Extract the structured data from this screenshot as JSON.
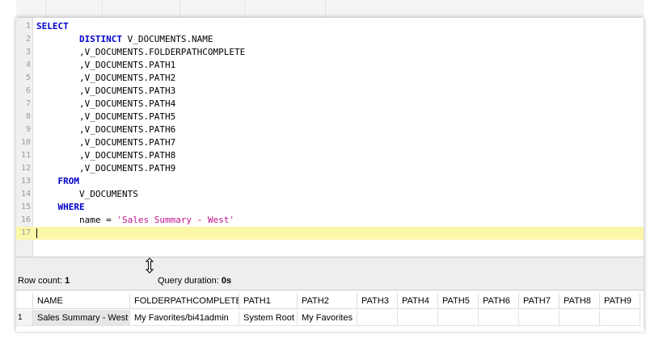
{
  "editor": {
    "lines": [
      {
        "n": "1",
        "segments": [
          {
            "t": "SELECT",
            "c": "kw"
          }
        ]
      },
      {
        "n": "2",
        "segments": [
          {
            "t": "        ",
            "c": ""
          },
          {
            "t": "DISTINCT",
            "c": "kw"
          },
          {
            "t": " V_DOCUMENTS.NAME",
            "c": ""
          }
        ]
      },
      {
        "n": "3",
        "segments": [
          {
            "t": "        ,V_DOCUMENTS.FOLDERPATHCOMPLETE",
            "c": ""
          }
        ]
      },
      {
        "n": "4",
        "segments": [
          {
            "t": "        ,V_DOCUMENTS.PATH1",
            "c": ""
          }
        ]
      },
      {
        "n": "5",
        "segments": [
          {
            "t": "        ,V_DOCUMENTS.PATH2",
            "c": ""
          }
        ]
      },
      {
        "n": "6",
        "segments": [
          {
            "t": "        ,V_DOCUMENTS.PATH3",
            "c": ""
          }
        ]
      },
      {
        "n": "7",
        "segments": [
          {
            "t": "        ,V_DOCUMENTS.PATH4",
            "c": ""
          }
        ]
      },
      {
        "n": "8",
        "segments": [
          {
            "t": "        ,V_DOCUMENTS.PATH5",
            "c": ""
          }
        ]
      },
      {
        "n": "9",
        "segments": [
          {
            "t": "        ,V_DOCUMENTS.PATH6",
            "c": ""
          }
        ]
      },
      {
        "n": "10",
        "segments": [
          {
            "t": "        ,V_DOCUMENTS.PATH7",
            "c": ""
          }
        ]
      },
      {
        "n": "11",
        "segments": [
          {
            "t": "        ,V_DOCUMENTS.PATH8",
            "c": ""
          }
        ]
      },
      {
        "n": "12",
        "segments": [
          {
            "t": "        ,V_DOCUMENTS.PATH9",
            "c": ""
          }
        ]
      },
      {
        "n": "13",
        "segments": [
          {
            "t": "    ",
            "c": ""
          },
          {
            "t": "FROM",
            "c": "kw"
          }
        ]
      },
      {
        "n": "14",
        "segments": [
          {
            "t": "        V_DOCUMENTS",
            "c": ""
          }
        ]
      },
      {
        "n": "15",
        "segments": [
          {
            "t": "    ",
            "c": ""
          },
          {
            "t": "WHERE",
            "c": "kw"
          }
        ]
      },
      {
        "n": "16",
        "segments": [
          {
            "t": "        name = ",
            "c": ""
          },
          {
            "t": "'Sales Summary - West'",
            "c": "str"
          }
        ]
      },
      {
        "n": "17",
        "segments": [],
        "current": true
      }
    ],
    "keyword_color": "#0000cc",
    "string_color": "#c0148c",
    "current_line_color": "#fbf7a8"
  },
  "stats": {
    "row_count_label": "Row count:",
    "row_count_value": "1",
    "query_duration_label": "Query duration:",
    "query_duration_value": "0s"
  },
  "results": {
    "columns": [
      "NAME",
      "FOLDERPATHCOMPLETE",
      "PATH1",
      "PATH2",
      "PATH3",
      "PATH4",
      "PATH5",
      "PATH6",
      "PATH7",
      "PATH8",
      "PATH9"
    ],
    "rows": [
      {
        "row_number": "1",
        "cells": [
          "Sales Summary - West",
          "My Favorites/bi41admin",
          "System Root",
          "My Favorites",
          "",
          "",
          "",
          "",
          "",
          "",
          ""
        ]
      }
    ]
  }
}
